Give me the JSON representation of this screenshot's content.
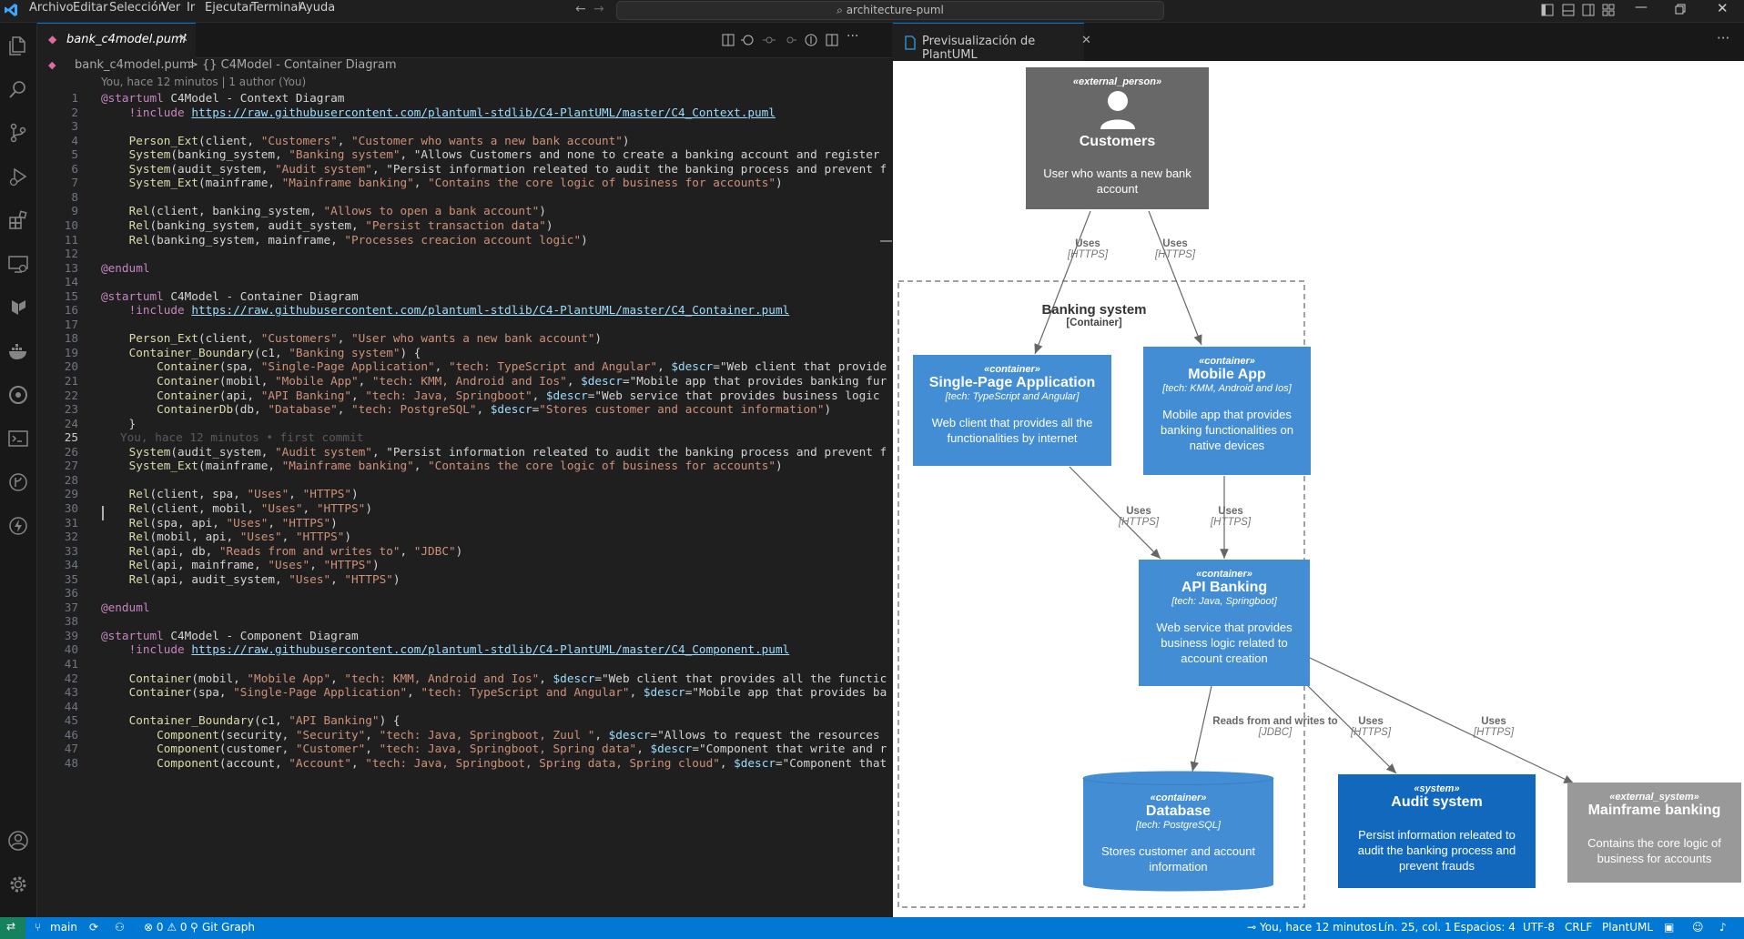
{
  "menu": [
    "Archivo",
    "Editar",
    "Selección",
    "Ver",
    "Ir",
    "Ejecutar",
    "Terminal",
    "Ayuda"
  ],
  "command_center": "architecture-puml",
  "editor": {
    "tab_label": "bank_c4model.puml",
    "breadcrumb_file": "bank_c4model.puml",
    "breadcrumb_sep": ">",
    "breadcrumb_symbol": "{} C4Model - Container Diagram",
    "blame_header": "You, hace 12 minutos | 1 author (You)",
    "inline_blame": "You, hace 12 minutos • first commit",
    "lines": [
      "@startuml C4Model - Context Diagram",
      "    !include https://raw.githubusercontent.com/plantuml-stdlib/C4-PlantUML/master/C4_Context.puml",
      "",
      "    Person_Ext(client, \"Customers\", \"Customer who wants a new bank account\")",
      "    System(banking_system, \"Banking system\", \"Allows Customers and none to create a banking account and register",
      "    System(audit_system, \"Audit system\", \"Persist information releated to audit the banking process and prevent f",
      "    System_Ext(mainframe, \"Mainframe banking\", \"Contains the core logic of business for accounts\")",
      "",
      "    Rel(client, banking_system, \"Allows to open a bank account\")",
      "    Rel(banking_system, audit_system, \"Persist transaction data\")",
      "    Rel(banking_system, mainframe, \"Processes creacion account logic\")",
      "",
      "@enduml",
      "",
      "@startuml C4Model - Container Diagram",
      "    !include https://raw.githubusercontent.com/plantuml-stdlib/C4-PlantUML/master/C4_Container.puml",
      "",
      "    Person_Ext(client, \"Customers\", \"User who wants a new bank account\")",
      "    Container_Boundary(c1, \"Banking system\") {",
      "        Container(spa, \"Single-Page Application\", \"tech: TypeScript and Angular\", $descr=\"Web client that provide",
      "        Container(mobil, \"Mobile App\", \"tech: KMM, Android and Ios\", $descr=\"Mobile app that provides banking fur",
      "        Container(api, \"API Banking\", \"tech: Java, Springboot\", $descr=\"Web service that provides business logic",
      "        ContainerDb(db, \"Database\", \"tech: PostgreSQL\", $descr=\"Stores customer and account information\")",
      "    }",
      "",
      "    System(audit_system, \"Audit system\", \"Persist information releated to audit the banking process and prevent f",
      "    System_Ext(mainframe, \"Mainframe banking\", \"Contains the core logic of business for accounts\")",
      "",
      "    Rel(client, spa, \"Uses\", \"HTTPS\")",
      "    Rel(client, mobil, \"Uses\", \"HTTPS\")",
      "    Rel(spa, api, \"Uses\", \"HTTPS\")",
      "    Rel(mobil, api, \"Uses\", \"HTTPS\")",
      "    Rel(api, db, \"Reads from and writes to\", \"JDBC\")",
      "    Rel(api, mainframe, \"Uses\", \"HTTPS\")",
      "    Rel(api, audit_system, \"Uses\", \"HTTPS\")",
      "",
      "@enduml",
      "",
      "@startuml C4Model - Component Diagram",
      "    !include https://raw.githubusercontent.com/plantuml-stdlib/C4-PlantUML/master/C4_Component.puml",
      "",
      "    Container(mobil, \"Mobile App\", \"tech: KMM, Android and Ios\", $descr=\"Web client that provides all the functic",
      "    Container(spa, \"Single-Page Application\", \"tech: TypeScript and Angular\", $descr=\"Mobile app that provides ba",
      "",
      "    Container_Boundary(c1, \"API Banking\") {",
      "        Component(security, \"Security\", \"tech: Java, Springboot, Zuul \", $descr=\"Allows to request the resources",
      "        Component(customer, \"Customer\", \"tech: Java, Springboot, Spring data\", $descr=\"Component that write and r",
      "        Component(account, \"Account\", \"tech: Java, Springboot, Spring data, Spring cloud\", $descr=\"Component that"
    ]
  },
  "preview": {
    "tab_label": "Previsualización de PlantUML",
    "diagram": {
      "customers": {
        "stereo": "«external_person»",
        "title": "Customers",
        "desc": "User who wants a new bank account"
      },
      "boundary": {
        "title": "Banking system",
        "subtitle": "[Container]"
      },
      "spa": {
        "stereo": "«container»",
        "title": "Single-Page Application",
        "tech": "[tech: TypeScript and Angular]",
        "desc": "Web client that provides all the functionalities by internet"
      },
      "mobile": {
        "stereo": "«container»",
        "title": "Mobile App",
        "tech": "[tech: KMM, Android and Ios]",
        "desc": "Mobile app that provides banking functionalities on native devices"
      },
      "api": {
        "stereo": "«container»",
        "title": "API Banking",
        "tech": "[tech: Java, Springboot]",
        "desc": "Web service that provides business logic related to account creation"
      },
      "db": {
        "stereo": "«container»",
        "title": "Database",
        "tech": "[tech: PostgreSQL]",
        "desc": "Stores customer and account information"
      },
      "audit": {
        "stereo": "«system»",
        "title": "Audit system",
        "desc": "Persist information releated to audit the banking process and prevent frauds"
      },
      "mainframe": {
        "stereo": "«external_system»",
        "title": "Mainframe banking",
        "desc": "Contains the core logic of business for accounts"
      },
      "rel_uses": "Uses",
      "rel_https": "[HTTPS]",
      "rel_db": "Reads from and writes to",
      "rel_jdbc": "[JDBC]"
    }
  },
  "status": {
    "branch": "main",
    "problems": "⊗ 0 ⚠ 0",
    "ports": "0",
    "git_graph": "Git Graph",
    "blame": "You, hace 12 minutos",
    "position": "Lín. 25, col. 1",
    "spaces": "Espacios: 4",
    "encoding": "UTF-8",
    "eol": "CRLF",
    "language": "PlantUML"
  },
  "colors": {
    "accent": "#0078d4",
    "person_ext": "#686868",
    "container": "#438dd5",
    "system": "#1168bd",
    "system_ext": "#999999"
  }
}
